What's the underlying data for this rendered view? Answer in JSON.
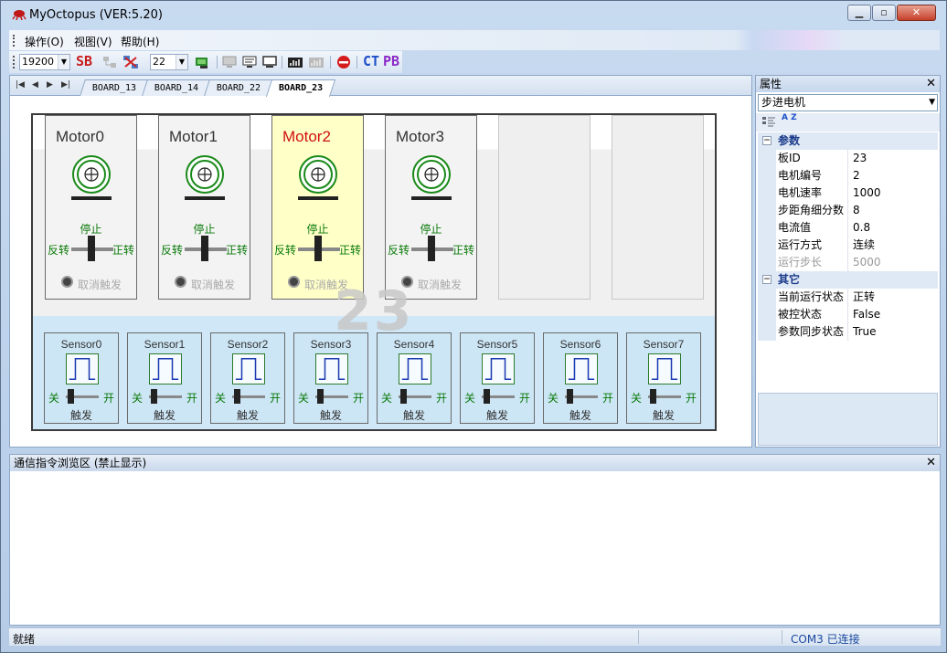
{
  "window": {
    "title": "MyOctopus   (VER:5.20)"
  },
  "menu": {
    "items": [
      "操作(O)",
      "视图(V)",
      "帮助(H)"
    ]
  },
  "toolbar": {
    "baud": "19200",
    "sb_label": "SB",
    "port": "22",
    "ct_label": "CT",
    "pb_label": "PB"
  },
  "tabs": [
    "BOARD_13",
    "BOARD_14",
    "BOARD_22",
    "BOARD_23"
  ],
  "active_tab": "BOARD_23",
  "board": {
    "watermark": "23",
    "motors": [
      {
        "name": "Motor0",
        "status": "停止",
        "reverse": "反转",
        "forward": "正转",
        "cancel": "取消触发"
      },
      {
        "name": "Motor1",
        "status": "停止",
        "reverse": "反转",
        "forward": "正转",
        "cancel": "取消触发"
      },
      {
        "name": "Motor2",
        "status": "停止",
        "reverse": "反转",
        "forward": "正转",
        "cancel": "取消触发"
      },
      {
        "name": "Motor3",
        "status": "停止",
        "reverse": "反转",
        "forward": "正转",
        "cancel": "取消触发"
      }
    ],
    "sensors": [
      {
        "name": "Sensor0",
        "off": "关",
        "on": "开",
        "trigger": "触发"
      },
      {
        "name": "Sensor1",
        "off": "关",
        "on": "开",
        "trigger": "触发"
      },
      {
        "name": "Sensor2",
        "off": "关",
        "on": "开",
        "trigger": "触发"
      },
      {
        "name": "Sensor3",
        "off": "关",
        "on": "开",
        "trigger": "触发"
      },
      {
        "name": "Sensor4",
        "off": "关",
        "on": "开",
        "trigger": "触发"
      },
      {
        "name": "Sensor5",
        "off": "关",
        "on": "开",
        "trigger": "触发"
      },
      {
        "name": "Sensor6",
        "off": "关",
        "on": "开",
        "trigger": "触发"
      },
      {
        "name": "Sensor7",
        "off": "关",
        "on": "开",
        "trigger": "触发"
      }
    ]
  },
  "properties": {
    "header": "属性",
    "object": "步进电机",
    "sort_label": "A Z",
    "categories": [
      {
        "name": "参数",
        "toggle": "⊟",
        "rows": [
          {
            "key": "板ID",
            "value": "23"
          },
          {
            "key": "电机编号",
            "value": "2"
          },
          {
            "key": "电机速率",
            "value": "1000"
          },
          {
            "key": "步距角细分数",
            "value": "8"
          },
          {
            "key": "电流值",
            "value": "0.8"
          },
          {
            "key": "运行方式",
            "value": "连续"
          },
          {
            "key": "运行步长",
            "value": "5000"
          }
        ]
      },
      {
        "name": "其它",
        "toggle": "⊟",
        "rows": [
          {
            "key": "当前运行状态",
            "value": "正转"
          },
          {
            "key": "被控状态",
            "value": "False"
          },
          {
            "key": "参数同步状态",
            "value": "True"
          }
        ]
      }
    ]
  },
  "comm": {
    "title": "通信指令浏览区    (禁止显示)"
  },
  "status": {
    "left": "就绪",
    "right": "COM3 已连接"
  },
  "colors": {
    "selected_motor_bg": "#ffffc8",
    "selected_motor_name": "#d01010",
    "sensor_area": "#cfe7f7",
    "ok_text": "#0a7a0a"
  },
  "icons": [
    "app-octopus-icon",
    "close-icon",
    "minimize-icon",
    "maximize-icon"
  ]
}
